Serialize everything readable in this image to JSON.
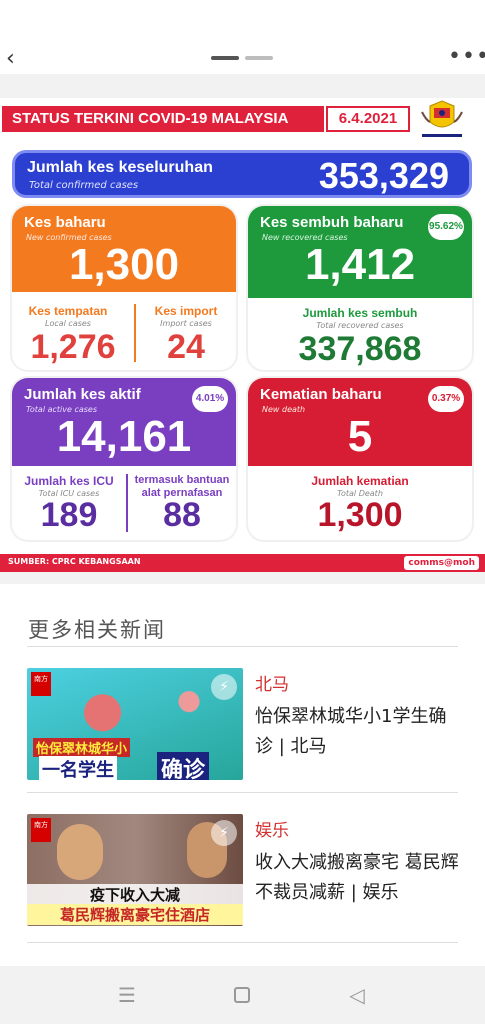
{
  "topbar": {
    "back_icon": "chevron-left-icon",
    "more_icon": "more-dots-icon"
  },
  "infographic": {
    "title": "STATUS TERKINI COVID-19 MALAYSIA",
    "date": "6.4.2021",
    "crest_text": "KEMENTERIAN KESIHATAN MALAYSIA",
    "total": {
      "label": "Jumlah kes keseluruhan",
      "sub": "Total confirmed cases",
      "value": "353,329"
    },
    "new_cases": {
      "label": "Kes baharu",
      "sub": "New confirmed cases",
      "value": "1,300",
      "local_label": "Kes tempatan",
      "local_sub": "Local cases",
      "local_value": "1,276",
      "import_label": "Kes import",
      "import_sub": "Import cases",
      "import_value": "24"
    },
    "recovered": {
      "label": "Kes sembuh baharu",
      "sub": "New recovered cases",
      "value": "1,412",
      "pct": "95.62%",
      "total_label": "Jumlah kes sembuh",
      "total_sub": "Total recovered cases",
      "total_value": "337,868"
    },
    "active": {
      "label": "Jumlah kes aktif",
      "sub": "Total active cases",
      "value": "14,161",
      "pct": "4.01%",
      "icu_label": "Jumlah kes ICU",
      "icu_sub": "Total ICU cases",
      "icu_value": "189",
      "vent_label1": "termasuk bantuan",
      "vent_label2": "alat pernafasan",
      "vent_value": "88"
    },
    "deaths": {
      "label": "Kematian baharu",
      "sub": "New death",
      "value": "5",
      "pct": "0.37%",
      "total_label": "Jumlah kematian",
      "total_sub": "Total Death",
      "total_value": "1,300"
    },
    "source": "SUMBER: CPRC KEBANGSAAN",
    "handle": "comms@moh",
    "colors": {
      "red": "#e0213c",
      "blue": "#2b3fd1",
      "orange": "#f47a20",
      "green": "#1e9a3d",
      "purple": "#7a3fc1",
      "crimson": "#d71d33"
    }
  },
  "related": {
    "title": "更多相关新闻",
    "items": [
      {
        "category": "北马",
        "headline": "怡保翠林城华小1学生确诊 | 北马",
        "thumb_text1": "怡保翠林城华小",
        "thumb_text2": "一名学生",
        "thumb_text3": "确诊",
        "badge": "南方 ONLINE"
      },
      {
        "category": "娱乐",
        "headline": "收入大减搬离豪宅 葛民辉不裁员减薪 | 娱乐",
        "thumb_text1": "疫下收入大减",
        "thumb_text2": "葛民辉搬离豪宅住酒店",
        "badge": "南方 ONLINE"
      }
    ]
  },
  "navbar": {
    "menu_icon": "menu-icon",
    "home_icon": "home-square-icon",
    "back_icon": "back-triangle-icon"
  }
}
